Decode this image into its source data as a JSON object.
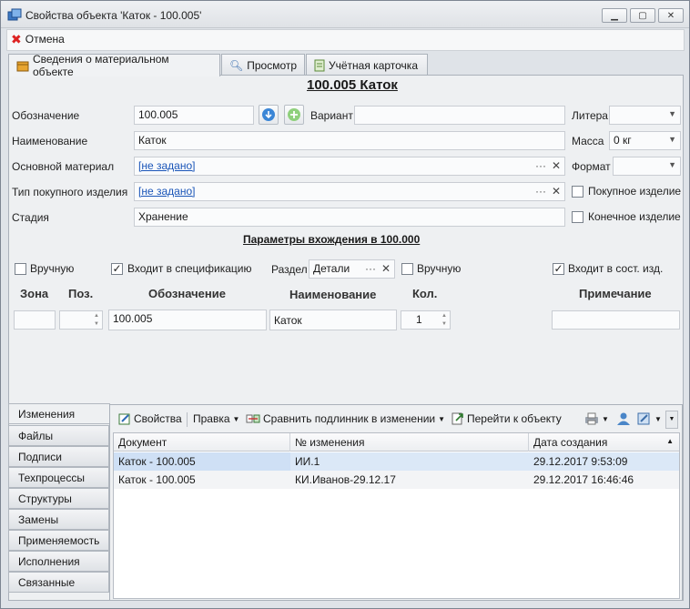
{
  "window": {
    "title": "Свойства объекта 'Каток - 100.005'"
  },
  "toolbar": {
    "cancel_label": "Отмена"
  },
  "tabs": [
    {
      "label": "Сведения о материальном объекте"
    },
    {
      "label": "Просмотр"
    },
    {
      "label": "Учётная карточка"
    }
  ],
  "object": {
    "heading": "100.005 Каток",
    "designation_label": "Обозначение",
    "designation_value": "100.005",
    "variant_label": "Вариант",
    "variant_value": "",
    "litera_label": "Литера",
    "litera_value": "",
    "name_label": "Наименование",
    "name_value": "Каток",
    "mass_label": "Масса",
    "mass_value": "0 кг",
    "material_label": "Основной материал",
    "material_value": "[не задано]",
    "format_label": "Формат",
    "format_value": "",
    "purchase_type_label": "Тип покупного изделия",
    "purchase_type_value": "[не задано]",
    "purchased_label": "Покупное изделие",
    "stage_label": "Стадия",
    "stage_value": "Хранение",
    "final_label": "Конечное изделие",
    "ellipsis": "···",
    "clear": "✕"
  },
  "params": {
    "heading": "Параметры вхождения в 100.000",
    "manual1_label": "Вручную",
    "in_spec_label": "Входит в спецификацию",
    "section_label": "Раздел",
    "section_value": "Детали",
    "manual2_label": "Вручную",
    "in_assembly_label": "Входит в сост. изд.",
    "col_zone": "Зона",
    "col_pos": "Поз.",
    "col_designation": "Обозначение",
    "col_name": "Наименование",
    "col_qty": "Кол.",
    "col_note": "Примечание",
    "designation_value": "100.005",
    "name_value": "Каток",
    "qty_value": "1"
  },
  "side_tabs": [
    "Изменения",
    "Файлы",
    "Подписи",
    "Техпроцессы",
    "Структуры",
    "Замены",
    "Применяемость",
    "Исполнения",
    "Связанные"
  ],
  "changes_toolbar": {
    "properties": "Свойства",
    "edit": "Правка",
    "compare": "Сравнить подлинник в изменении",
    "goto": "Перейти к объекту"
  },
  "changes_grid": {
    "columns": [
      "Документ",
      "№ изменения",
      "Дата создания"
    ],
    "rows": [
      [
        "Каток - 100.005",
        "ИИ.1",
        "29.12.2017 9:53:09"
      ],
      [
        "Каток - 100.005",
        "КИ.Иванов-29.12.17",
        "29.12.2017 16:46:46"
      ]
    ]
  }
}
